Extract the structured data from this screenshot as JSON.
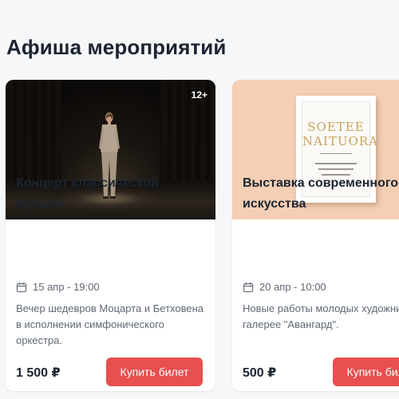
{
  "page": {
    "title": "Афиша мероприятий"
  },
  "events": [
    {
      "title": "Концерт классической музыки",
      "date": "15 апр - 19:00",
      "description": "Вечер шедевров Моцарта и Бетховена в исполнении симфонического оркестра.",
      "price": "1 500 ₽",
      "button_label": "Купить билет",
      "age_rating": "12+",
      "image_icon": "concert-stage-photo"
    },
    {
      "title": "Выставка современного искусства",
      "date": "20 апр - 10:00",
      "description": "Новые работы молодых художников в галерее \"Авангард\".",
      "price": "500 ₽",
      "button_label": "Купить билет",
      "image_icon": "framed-poster-photo",
      "poster_text": [
        "SOETEE",
        "NAITUORA"
      ]
    }
  ],
  "colors": {
    "accent": "#e84f4f",
    "background": "#f6f7f9",
    "card": "#ffffff",
    "text": "#1b2431",
    "muted": "#606874"
  }
}
